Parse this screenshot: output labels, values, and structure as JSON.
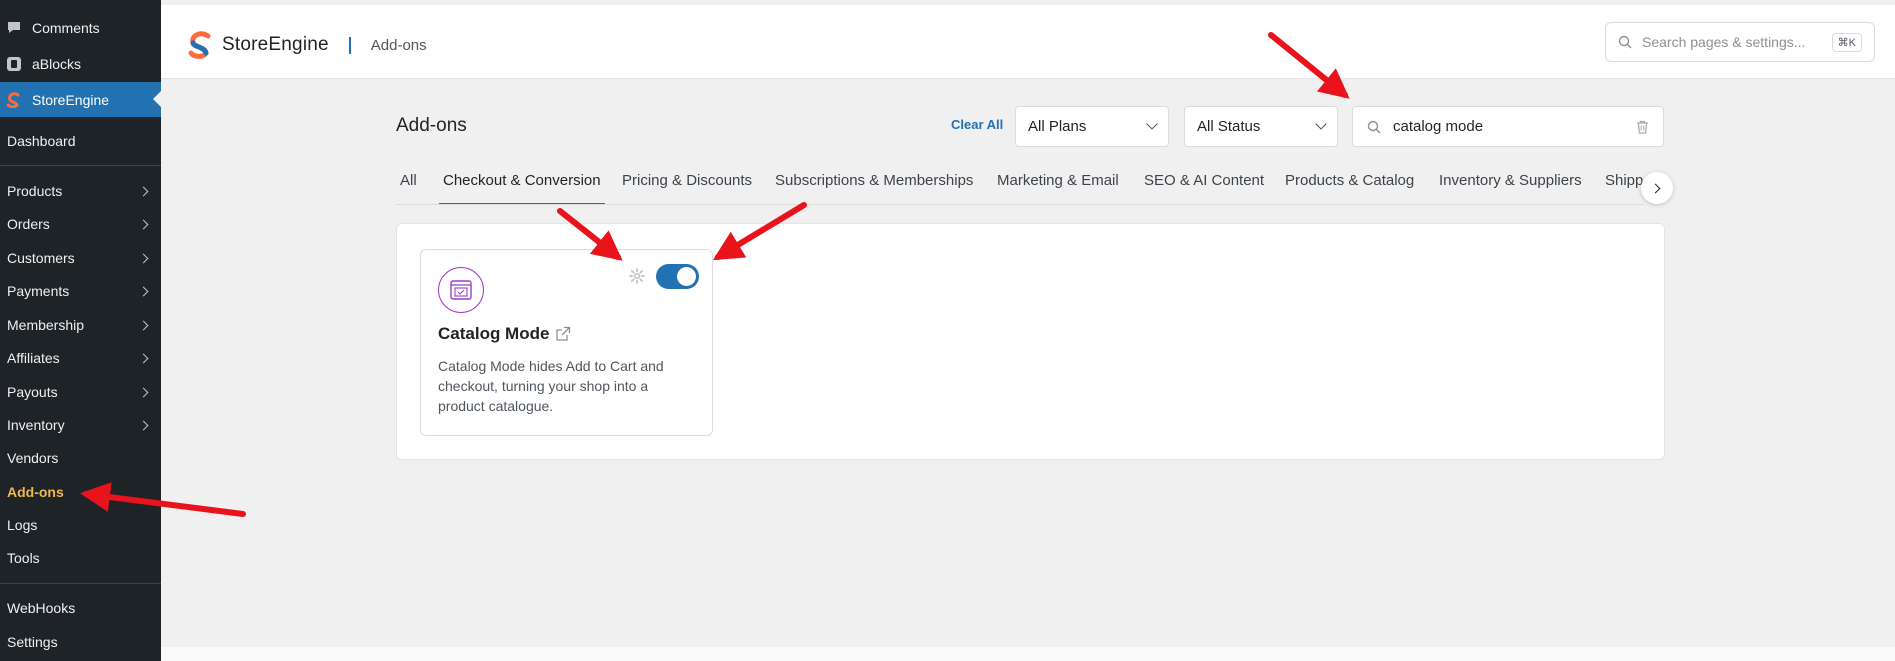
{
  "sidebar": {
    "top_items": [
      {
        "label": "Comments",
        "icon": "comments-icon"
      },
      {
        "label": "aBlocks",
        "icon": "ablocks-icon"
      },
      {
        "label": "StoreEngine",
        "icon": "storeengine-icon"
      }
    ],
    "sub_items": [
      {
        "label": "Dashboard"
      },
      {
        "label": "Products"
      },
      {
        "label": "Orders"
      },
      {
        "label": "Customers"
      },
      {
        "label": "Payments"
      },
      {
        "label": "Membership"
      },
      {
        "label": "Affiliates"
      },
      {
        "label": "Payouts"
      },
      {
        "label": "Inventory"
      },
      {
        "label": "Vendors"
      },
      {
        "label": "Add-ons"
      },
      {
        "label": "Logs"
      },
      {
        "label": "Tools"
      },
      {
        "label": "WebHooks"
      },
      {
        "label": "Settings"
      }
    ]
  },
  "header": {
    "brand": "StoreEngine",
    "breadcrumb": "Add-ons",
    "search_placeholder": "Search pages & settings...",
    "shortcut": "⌘K"
  },
  "main": {
    "title": "Add-ons",
    "clear_all": "Clear All",
    "plans_select": "All Plans",
    "status_select": "All Status",
    "search_value": "catalog mode",
    "tabs": [
      {
        "label": "All"
      },
      {
        "label": "Checkout & Conversion"
      },
      {
        "label": "Pricing & Discounts"
      },
      {
        "label": "Subscriptions & Memberships"
      },
      {
        "label": "Marketing & Email"
      },
      {
        "label": "SEO & AI Content"
      },
      {
        "label": "Products & Catalog"
      },
      {
        "label": "Inventory & Suppliers"
      },
      {
        "label": "Shipping"
      }
    ],
    "active_tab": "Checkout & Conversion",
    "card": {
      "title": "Catalog Mode",
      "description": "Catalog Mode hides Add to Cart and checkout, turning your shop into a product catalogue.",
      "enabled": true,
      "icon": "catalog-icon"
    }
  },
  "colors": {
    "sidebar_bg": "#1d2327",
    "accent": "#2271b1",
    "current_menu": "#f0b849",
    "annotation_arrow": "#e8131b",
    "card_icon": "#9b3fc4"
  }
}
